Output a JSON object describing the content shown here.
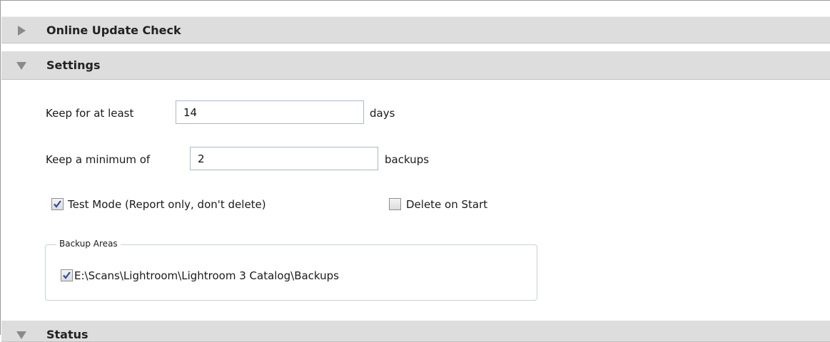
{
  "sections": {
    "online_update": {
      "title": "Online Update Check",
      "expanded": false
    },
    "settings": {
      "title": "Settings",
      "expanded": true
    },
    "status": {
      "title": "Status",
      "expanded": true
    }
  },
  "settings": {
    "keep_days": {
      "label": "Keep for at least",
      "value": "14",
      "suffix": "days"
    },
    "keep_min": {
      "label": "Keep a minimum of",
      "value": "2",
      "suffix": "backups"
    },
    "test_mode": {
      "label": "Test Mode (Report only, don't delete)",
      "checked": true
    },
    "delete_on_start": {
      "label": "Delete on Start",
      "checked": false
    },
    "backup_areas": {
      "legend": "Backup Areas",
      "items": [
        {
          "path": "E:\\Scans\\Lightroom\\Lightroom 3 Catalog\\Backups",
          "checked": true
        }
      ]
    }
  },
  "icons": {
    "collapsed": "triangle-right-icon",
    "expanded": "triangle-down-icon",
    "check": "checkmark-icon"
  },
  "colors": {
    "header_bg": "#dddddd",
    "arrow": "#8a8a8a",
    "check": "#2a4f9c"
  }
}
